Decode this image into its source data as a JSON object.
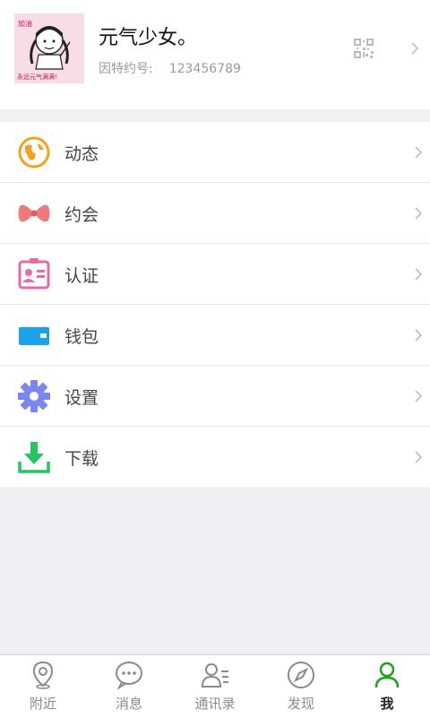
{
  "profile": {
    "name": "元气少女。",
    "id_label": "因特约号:",
    "id_value": "123456789",
    "avatar_text": [
      "加油",
      "永远元气满满!"
    ]
  },
  "menu": [
    {
      "label": "动态",
      "icon": "globe-icon",
      "color": "#f4a11f"
    },
    {
      "label": "约会",
      "icon": "bow-icon",
      "color": "#f07a7a"
    },
    {
      "label": "认证",
      "icon": "id-card-icon",
      "color": "#e86aa4"
    },
    {
      "label": "钱包",
      "icon": "wallet-icon",
      "color": "#1aa3e8"
    },
    {
      "label": "设置",
      "icon": "gear-icon",
      "color": "#7b86f0"
    },
    {
      "label": "下载",
      "icon": "download-icon",
      "color": "#22c55e"
    }
  ],
  "tabs": [
    {
      "label": "附近",
      "icon": "location-pin-icon"
    },
    {
      "label": "消息",
      "icon": "chat-bubble-icon"
    },
    {
      "label": "通讯录",
      "icon": "contacts-icon"
    },
    {
      "label": "发现",
      "icon": "compass-icon"
    },
    {
      "label": "我",
      "icon": "person-icon",
      "active": true,
      "color": "#1aa31a"
    }
  ]
}
